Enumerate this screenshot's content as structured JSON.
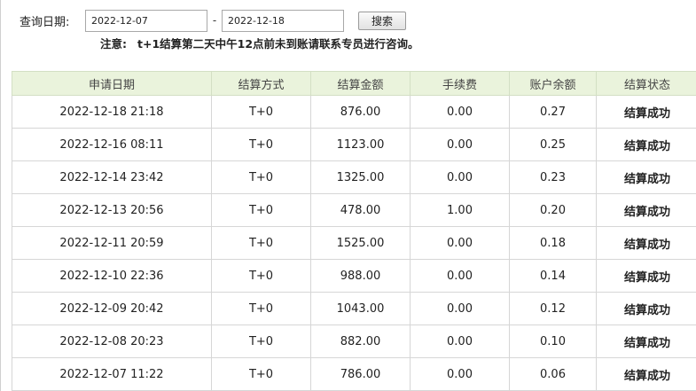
{
  "query": {
    "label": "查询日期:",
    "start_date": "2022-12-07",
    "separator": "-",
    "end_date": "2022-12-18",
    "search_label": "搜索"
  },
  "notice": {
    "label": "注意:",
    "text": "t+1结算第二天中午12点前未到账请联系专员进行咨询。"
  },
  "table": {
    "columns": [
      "申请日期",
      "结算方式",
      "结算金额",
      "手续费",
      "账户余额",
      "结算状态"
    ],
    "rows": [
      [
        "2022-12-18 21:18",
        "T+0",
        "876.00",
        "0.00",
        "0.27",
        "结算成功"
      ],
      [
        "2022-12-16 08:11",
        "T+0",
        "1123.00",
        "0.00",
        "0.25",
        "结算成功"
      ],
      [
        "2022-12-14 23:42",
        "T+0",
        "1325.00",
        "0.00",
        "0.23",
        "结算成功"
      ],
      [
        "2022-12-13 20:56",
        "T+0",
        "478.00",
        "1.00",
        "0.20",
        "结算成功"
      ],
      [
        "2022-12-11 20:59",
        "T+0",
        "1525.00",
        "0.00",
        "0.18",
        "结算成功"
      ],
      [
        "2022-12-10 22:36",
        "T+0",
        "988.00",
        "0.00",
        "0.14",
        "结算成功"
      ],
      [
        "2022-12-09 20:42",
        "T+0",
        "1043.00",
        "0.00",
        "0.12",
        "结算成功"
      ],
      [
        "2022-12-08 20:23",
        "T+0",
        "882.00",
        "0.00",
        "0.10",
        "结算成功"
      ],
      [
        "2022-12-07 11:22",
        "T+0",
        "786.00",
        "0.00",
        "0.06",
        "结算成功"
      ]
    ]
  }
}
